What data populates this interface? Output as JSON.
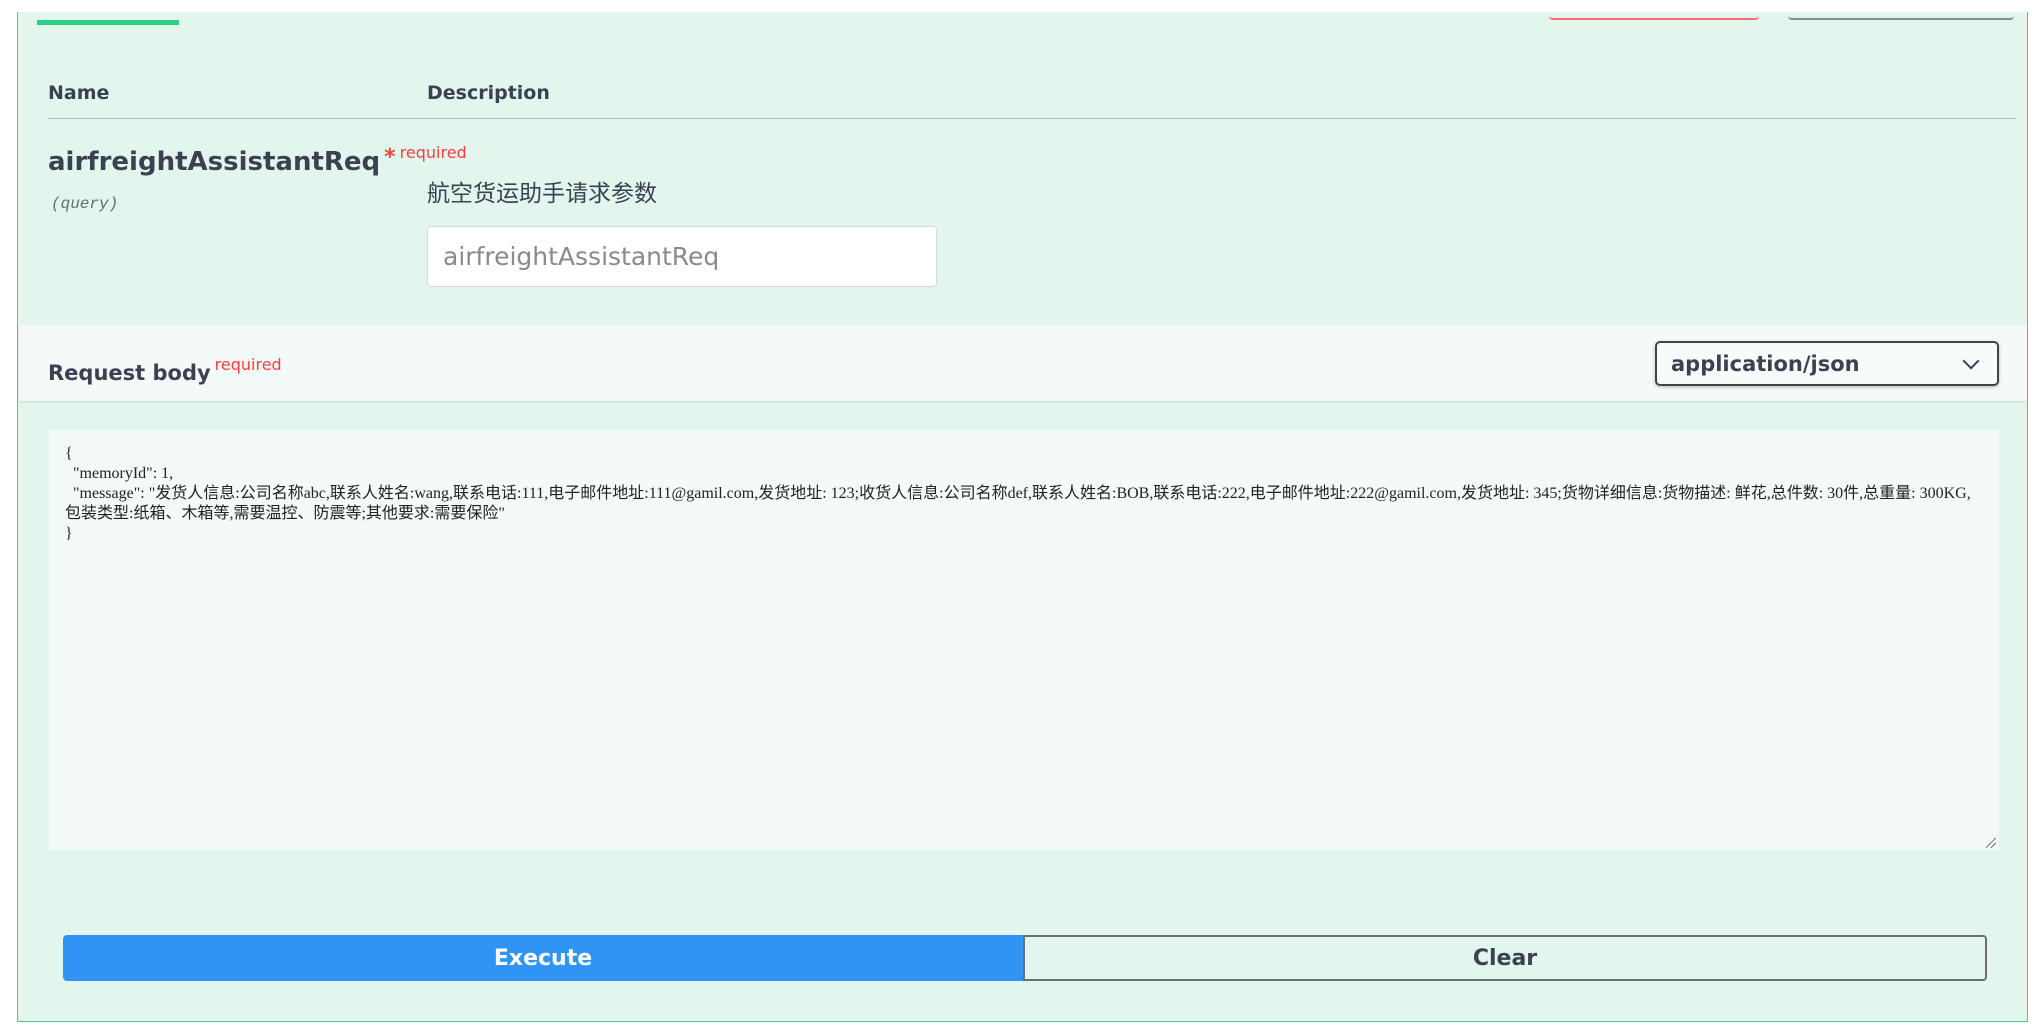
{
  "parameters": {
    "name_header": "Name",
    "description_header": "Description",
    "param": {
      "name": "airfreightAssistantReq",
      "required_star": "*",
      "required_label": "required",
      "location": "(query)",
      "description": "航空货运助手请求参数",
      "placeholder": "airfreightAssistantReq"
    }
  },
  "request_body": {
    "title": "Request body",
    "required_label": "required",
    "content_type": "application/json",
    "body": "{\n  \"memoryId\": 1,\n  \"message\": \"发货人信息:公司名称abc,联系人姓名:wang,联系电话:111,电子邮件地址:111@gamil.com,发货地址: 123;收货人信息:公司名称def,联系人姓名:BOB,联系电话:222,电子邮件地址:222@gamil.com,发货地址: 345;货物详细信息:货物描述: 鲜花,总件数: 30件,总重量: 300KG,包装类型:纸箱、木箱等,需要温控、防震等;其他要求:需要保险\"\n}"
  },
  "actions": {
    "execute_label": "Execute",
    "clear_label": "Clear"
  },
  "colors": {
    "panel_background": "#e3f6ee",
    "accent_green": "#49cc90",
    "execute_blue": "#3094f5",
    "required_red": "#f93e3e"
  }
}
